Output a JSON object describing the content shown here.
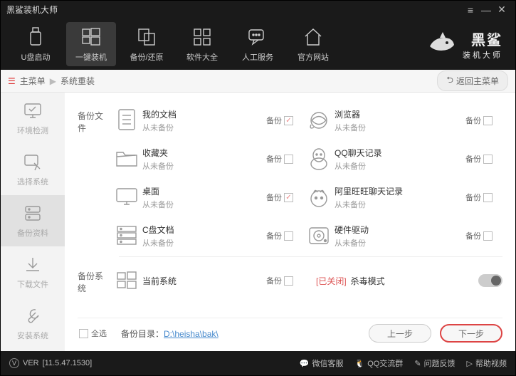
{
  "window": {
    "title": "黑鲨装机大师"
  },
  "topnav": {
    "items": [
      {
        "label": "U盘启动"
      },
      {
        "label": "一键装机"
      },
      {
        "label": "备份/还原"
      },
      {
        "label": "软件大全"
      },
      {
        "label": "人工服务"
      },
      {
        "label": "官方网站"
      }
    ]
  },
  "brand": {
    "name": "黑鲨",
    "sub": "装机大师"
  },
  "crumb": {
    "root": "主菜单",
    "current": "系统重装",
    "back": "返回主菜单"
  },
  "sidebar": {
    "items": [
      {
        "label": "环境检测"
      },
      {
        "label": "选择系统"
      },
      {
        "label": "备份资料"
      },
      {
        "label": "下载文件"
      },
      {
        "label": "安装系统"
      }
    ]
  },
  "sections": {
    "files_label": "备份文件",
    "system_label": "备份系统",
    "backup_word": "备份",
    "never": "从未备份",
    "left": [
      {
        "name": "我的文档",
        "checked": true
      },
      {
        "name": "收藏夹",
        "checked": false
      },
      {
        "name": "桌面",
        "checked": true
      },
      {
        "name": "C盘文档",
        "checked": false
      }
    ],
    "right": [
      {
        "name": "浏览器"
      },
      {
        "name": "QQ聊天记录"
      },
      {
        "name": "阿里旺旺聊天记录"
      },
      {
        "name": "硬件驱动"
      }
    ],
    "system": {
      "name": "当前系统"
    },
    "kill": {
      "closed": "[已关闭]",
      "label": "杀毒模式"
    }
  },
  "bottom": {
    "selectall": "全选",
    "dir_label": "备份目录：",
    "dir_path": "D:\\heisha\\bak\\",
    "prev": "上一步",
    "next": "下一步"
  },
  "status": {
    "ver_label": "VER",
    "ver": "[11.5.47.1530]",
    "links": [
      {
        "label": "微信客服"
      },
      {
        "label": "QQ交流群"
      },
      {
        "label": "问题反馈"
      },
      {
        "label": "帮助视频"
      }
    ]
  }
}
